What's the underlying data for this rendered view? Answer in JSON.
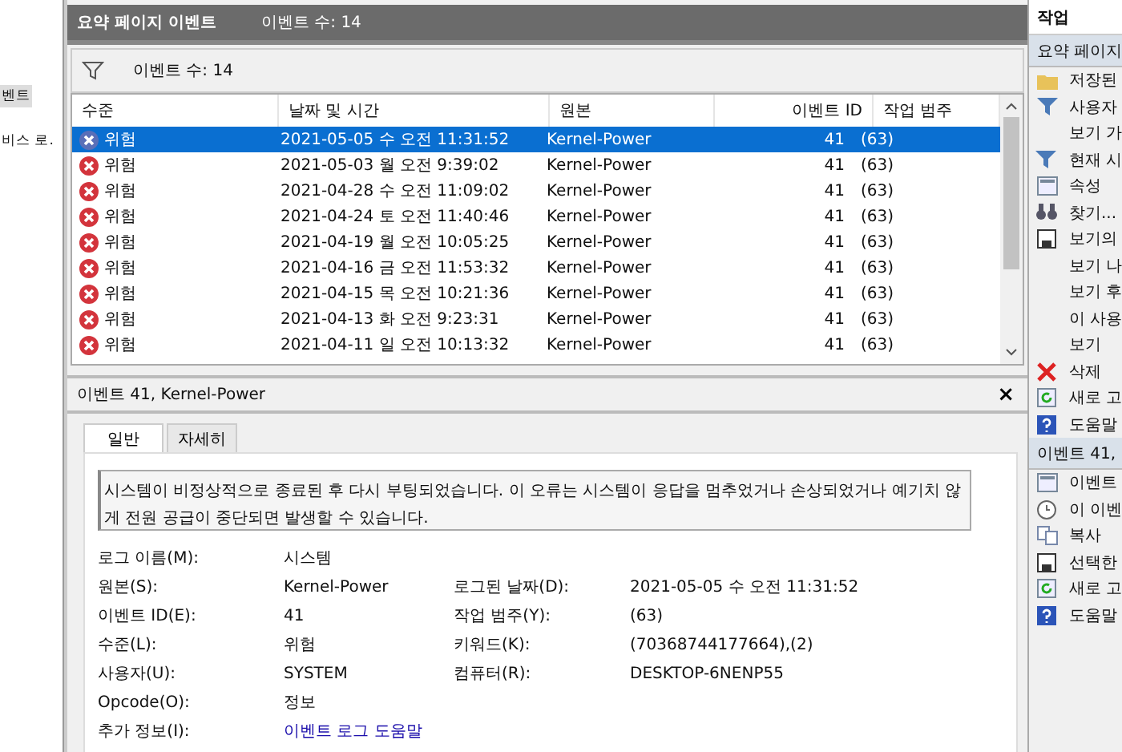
{
  "tree": {
    "items": [
      {
        "label": "벤트",
        "selected": true
      },
      {
        "label": "비스 로.",
        "selected": false
      }
    ]
  },
  "header": {
    "title": "요약 페이지 이벤트",
    "count": "이벤트 수: 14"
  },
  "filter_bar": {
    "text": "이벤트 수: 14"
  },
  "table": {
    "columns": [
      "수준",
      "날짜 및 시간",
      "원본",
      "이벤트 ID",
      "작업 범주"
    ],
    "rows": [
      {
        "level": "위험",
        "date": "2021-05-05 수 오전 11:31:52",
        "source": "Kernel-Power",
        "id": "41",
        "category": "(63)",
        "selected": true
      },
      {
        "level": "위험",
        "date": "2021-05-03 월 오전 9:39:02",
        "source": "Kernel-Power",
        "id": "41",
        "category": "(63)",
        "selected": false
      },
      {
        "level": "위험",
        "date": "2021-04-28 수 오전 11:09:02",
        "source": "Kernel-Power",
        "id": "41",
        "category": "(63)",
        "selected": false
      },
      {
        "level": "위험",
        "date": "2021-04-24 토 오전 11:40:46",
        "source": "Kernel-Power",
        "id": "41",
        "category": "(63)",
        "selected": false
      },
      {
        "level": "위험",
        "date": "2021-04-19 월 오전 10:05:25",
        "source": "Kernel-Power",
        "id": "41",
        "category": "(63)",
        "selected": false
      },
      {
        "level": "위험",
        "date": "2021-04-16 금 오전 11:53:32",
        "source": "Kernel-Power",
        "id": "41",
        "category": "(63)",
        "selected": false
      },
      {
        "level": "위험",
        "date": "2021-04-15 목 오전 10:21:36",
        "source": "Kernel-Power",
        "id": "41",
        "category": "(63)",
        "selected": false
      },
      {
        "level": "위험",
        "date": "2021-04-13 화 오전 9:23:31",
        "source": "Kernel-Power",
        "id": "41",
        "category": "(63)",
        "selected": false
      },
      {
        "level": "위험",
        "date": "2021-04-11 일 오전 10:13:32",
        "source": "Kernel-Power",
        "id": "41",
        "category": "(63)",
        "selected": false
      }
    ]
  },
  "detail": {
    "title": "이벤트 41, Kernel-Power",
    "close": "×",
    "tabs": [
      {
        "label": "일반",
        "selected": true
      },
      {
        "label": "자세히",
        "selected": false
      }
    ],
    "message": "시스템이 비정상적으로 종료된 후 다시 부팅되었습니다. 이 오류는 시스템이 응답을 멈추었거나 손상되었거나 예기치 않게 전원 공급이 중단되면 발생할 수 있습니다.",
    "fields": [
      {
        "label": "로그 이름(M):",
        "value": "시스템"
      },
      {
        "label": "원본(S):",
        "value": "Kernel-Power",
        "label2": "로그된 날짜(D):",
        "value2": "2021-05-05 수 오전 11:31:52"
      },
      {
        "label": "이벤트 ID(E):",
        "value": "41",
        "label2": "작업 범주(Y):",
        "value2": "(63)"
      },
      {
        "label": "수준(L):",
        "value": "위험",
        "label2": "키워드(K):",
        "value2": "(70368744177664),(2)"
      },
      {
        "label": "사용자(U):",
        "value": "SYSTEM",
        "label2": "컴퓨터(R):",
        "value2": "DESKTOP-6NENP55"
      },
      {
        "label": "Opcode(O):",
        "value": "정보"
      },
      {
        "label": "추가 정보(I):",
        "link": "이벤트 로그 도움말"
      }
    ]
  },
  "actions": {
    "title": "작업",
    "sections": [
      {
        "title": "요약 페이지",
        "items": [
          {
            "label": "저장된",
            "kind": "folder"
          },
          {
            "label": "사용자",
            "kind": "filter"
          },
          {
            "label": "보기 가",
            "kind": "none"
          },
          {
            "label": "현재 시",
            "kind": "filter"
          },
          {
            "label": "속성",
            "kind": "window"
          },
          {
            "label": "찾기...",
            "kind": "binoculars"
          },
          {
            "label": "보기의",
            "kind": "save"
          },
          {
            "label": "보기 나",
            "kind": "none"
          },
          {
            "label": "보기 후",
            "kind": "none"
          },
          {
            "label": "이 사용",
            "kind": "none"
          },
          {
            "label": "보기",
            "kind": "none"
          },
          {
            "label": "삭제",
            "kind": "delete"
          },
          {
            "label": "새로 고",
            "kind": "refresh"
          },
          {
            "label": "도움말",
            "kind": "help"
          }
        ]
      },
      {
        "title": "이벤트 41,",
        "items": [
          {
            "label": "이벤트",
            "kind": "window"
          },
          {
            "label": "이 이벤",
            "kind": "clock"
          },
          {
            "label": "복사",
            "kind": "copy"
          },
          {
            "label": "선택한",
            "kind": "save"
          },
          {
            "label": "새로 고",
            "kind": "refresh"
          },
          {
            "label": "도움말",
            "kind": "help"
          }
        ]
      }
    ]
  }
}
